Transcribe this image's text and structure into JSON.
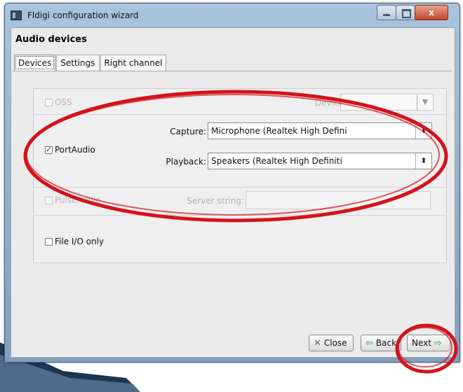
{
  "window": {
    "title": "Fldigi configuration wizard",
    "close_glyph": "x"
  },
  "page": {
    "heading": "Audio devices"
  },
  "tabs": [
    {
      "label": "Devices",
      "active": true
    },
    {
      "label": "Settings",
      "active": false
    },
    {
      "label": "Right channel",
      "active": false
    }
  ],
  "oss": {
    "label": "OSS",
    "checked": false,
    "enabled": false,
    "device_label": "Device:",
    "device_value": ""
  },
  "portaudio": {
    "label": "PortAudio",
    "checked": true,
    "capture_label": "Capture:",
    "capture_value": "Microphone (Realtek High Defini",
    "playback_label": "Playback:",
    "playback_value": "Speakers (Realtek High Definiti",
    "spin_glyph": "⬍"
  },
  "pulseaudio": {
    "label": "PulseAudio",
    "checked": false,
    "enabled": false,
    "server_label": "Server string:",
    "server_value": ""
  },
  "fileio": {
    "label": "File I/O only",
    "checked": false
  },
  "buttons": {
    "close": "Close",
    "back": "Back",
    "next": "Next"
  },
  "icons": {
    "close": "close-x-icon",
    "back": "green-arrow-left-icon",
    "next": "green-arrow-right-icon",
    "combo_arrow": "chevron-down-icon"
  },
  "colors": {
    "annotation": "#d4121b",
    "titlebar": "#8fb0cf",
    "accent_green": "#2e9e2e"
  }
}
